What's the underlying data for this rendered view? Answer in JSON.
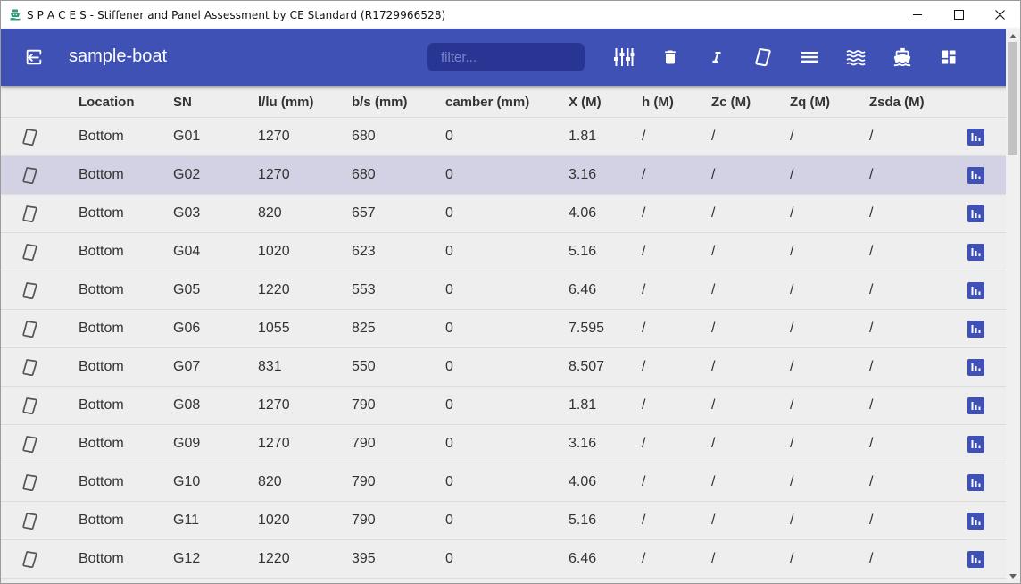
{
  "window": {
    "title": "S P A C E S - Stiffener and Panel Assessment by CE Standard (R1729966528)",
    "icon": "boat-icon",
    "controls": [
      "minimize-icon",
      "maximize-icon",
      "close-icon"
    ]
  },
  "toolbar": {
    "back_icon": "exit-to-app-icon",
    "project_name": "sample-boat",
    "filter_placeholder": "filter...",
    "filter_value": "",
    "tools": [
      "tune-icon",
      "trash-icon",
      "italic-icon",
      "panel-icon",
      "layers-icon",
      "waves-icon",
      "ship-icon",
      "dashboard-icon"
    ],
    "accent": "#3f51b5",
    "filter_bg": "#283593"
  },
  "table": {
    "columns": [
      "Location",
      "SN",
      "l/lu (mm)",
      "b/s (mm)",
      "camber (mm)",
      "X (M)",
      "h (M)",
      "Zc (M)",
      "Zq (M)",
      "Zsda (M)"
    ],
    "selected_row": "G02",
    "rows": [
      {
        "location": "Bottom",
        "sn": "G01",
        "l": "1270",
        "b": "680",
        "camber": "0",
        "x": "1.81",
        "h": "/",
        "zc": "/",
        "zq": "/",
        "zsda": "/"
      },
      {
        "location": "Bottom",
        "sn": "G02",
        "l": "1270",
        "b": "680",
        "camber": "0",
        "x": "3.16",
        "h": "/",
        "zc": "/",
        "zq": "/",
        "zsda": "/"
      },
      {
        "location": "Bottom",
        "sn": "G03",
        "l": "820",
        "b": "657",
        "camber": "0",
        "x": "4.06",
        "h": "/",
        "zc": "/",
        "zq": "/",
        "zsda": "/"
      },
      {
        "location": "Bottom",
        "sn": "G04",
        "l": "1020",
        "b": "623",
        "camber": "0",
        "x": "5.16",
        "h": "/",
        "zc": "/",
        "zq": "/",
        "zsda": "/"
      },
      {
        "location": "Bottom",
        "sn": "G05",
        "l": "1220",
        "b": "553",
        "camber": "0",
        "x": "6.46",
        "h": "/",
        "zc": "/",
        "zq": "/",
        "zsda": "/"
      },
      {
        "location": "Bottom",
        "sn": "G06",
        "l": "1055",
        "b": "825",
        "camber": "0",
        "x": "7.595",
        "h": "/",
        "zc": "/",
        "zq": "/",
        "zsda": "/"
      },
      {
        "location": "Bottom",
        "sn": "G07",
        "l": "831",
        "b": "550",
        "camber": "0",
        "x": "8.507",
        "h": "/",
        "zc": "/",
        "zq": "/",
        "zsda": "/"
      },
      {
        "location": "Bottom",
        "sn": "G08",
        "l": "1270",
        "b": "790",
        "camber": "0",
        "x": "1.81",
        "h": "/",
        "zc": "/",
        "zq": "/",
        "zsda": "/"
      },
      {
        "location": "Bottom",
        "sn": "G09",
        "l": "1270",
        "b": "790",
        "camber": "0",
        "x": "3.16",
        "h": "/",
        "zc": "/",
        "zq": "/",
        "zsda": "/"
      },
      {
        "location": "Bottom",
        "sn": "G10",
        "l": "820",
        "b": "790",
        "camber": "0",
        "x": "4.06",
        "h": "/",
        "zc": "/",
        "zq": "/",
        "zsda": "/"
      },
      {
        "location": "Bottom",
        "sn": "G11",
        "l": "1020",
        "b": "790",
        "camber": "0",
        "x": "5.16",
        "h": "/",
        "zc": "/",
        "zq": "/",
        "zsda": "/"
      },
      {
        "location": "Bottom",
        "sn": "G12",
        "l": "1220",
        "b": "395",
        "camber": "0",
        "x": "6.46",
        "h": "/",
        "zc": "/",
        "zq": "/",
        "zsda": "/"
      }
    ],
    "row_icon": "panel-icon",
    "action_icon": "bar-chart-icon",
    "selected_color": "#d2d2e4"
  }
}
